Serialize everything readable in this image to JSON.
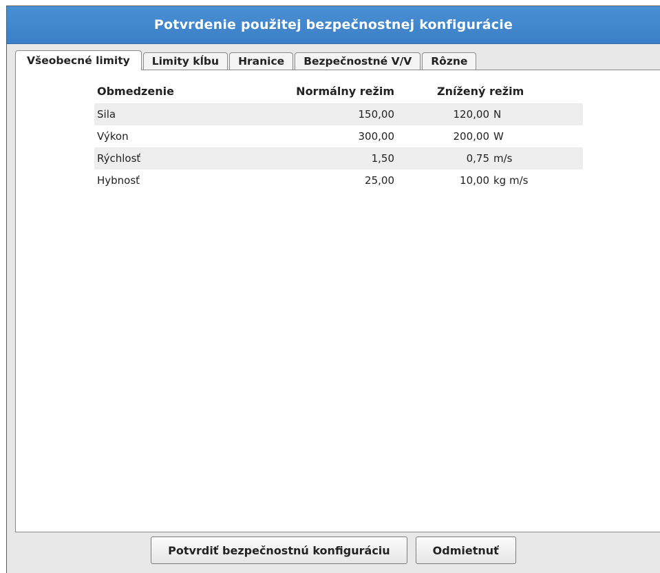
{
  "dialog": {
    "title": "Potvrdenie použitej bezpečnostnej konfigurácie"
  },
  "tabs": [
    {
      "label": "Všeobecné limity",
      "active": true
    },
    {
      "label": "Limity kĺbu",
      "active": false
    },
    {
      "label": "Hranice",
      "active": false
    },
    {
      "label": "Bezpečnostné V/V",
      "active": false
    },
    {
      "label": "Rôzne",
      "active": false
    }
  ],
  "limits_table": {
    "headers": {
      "limit": "Obmedzenie",
      "normal": "Normálny režim",
      "reduced": "Znížený režim"
    },
    "rows": [
      {
        "name": "Sila",
        "normal": "150,00",
        "reduced": "120,00",
        "unit": "N"
      },
      {
        "name": "Výkon",
        "normal": "300,00",
        "reduced": "200,00",
        "unit": "W"
      },
      {
        "name": "Rýchlosť",
        "normal": "1,50",
        "reduced": "0,75",
        "unit": "m/s"
      },
      {
        "name": "Hybnosť",
        "normal": "25,00",
        "reduced": "10,00",
        "unit": "kg m/s"
      }
    ]
  },
  "buttons": {
    "confirm": "Potvrdiť bezpečnostnú konfiguráciu",
    "reject": "Odmietnuť"
  },
  "colors": {
    "title_bar": "#3b7fc6",
    "row_shade": "#eeeeee"
  }
}
